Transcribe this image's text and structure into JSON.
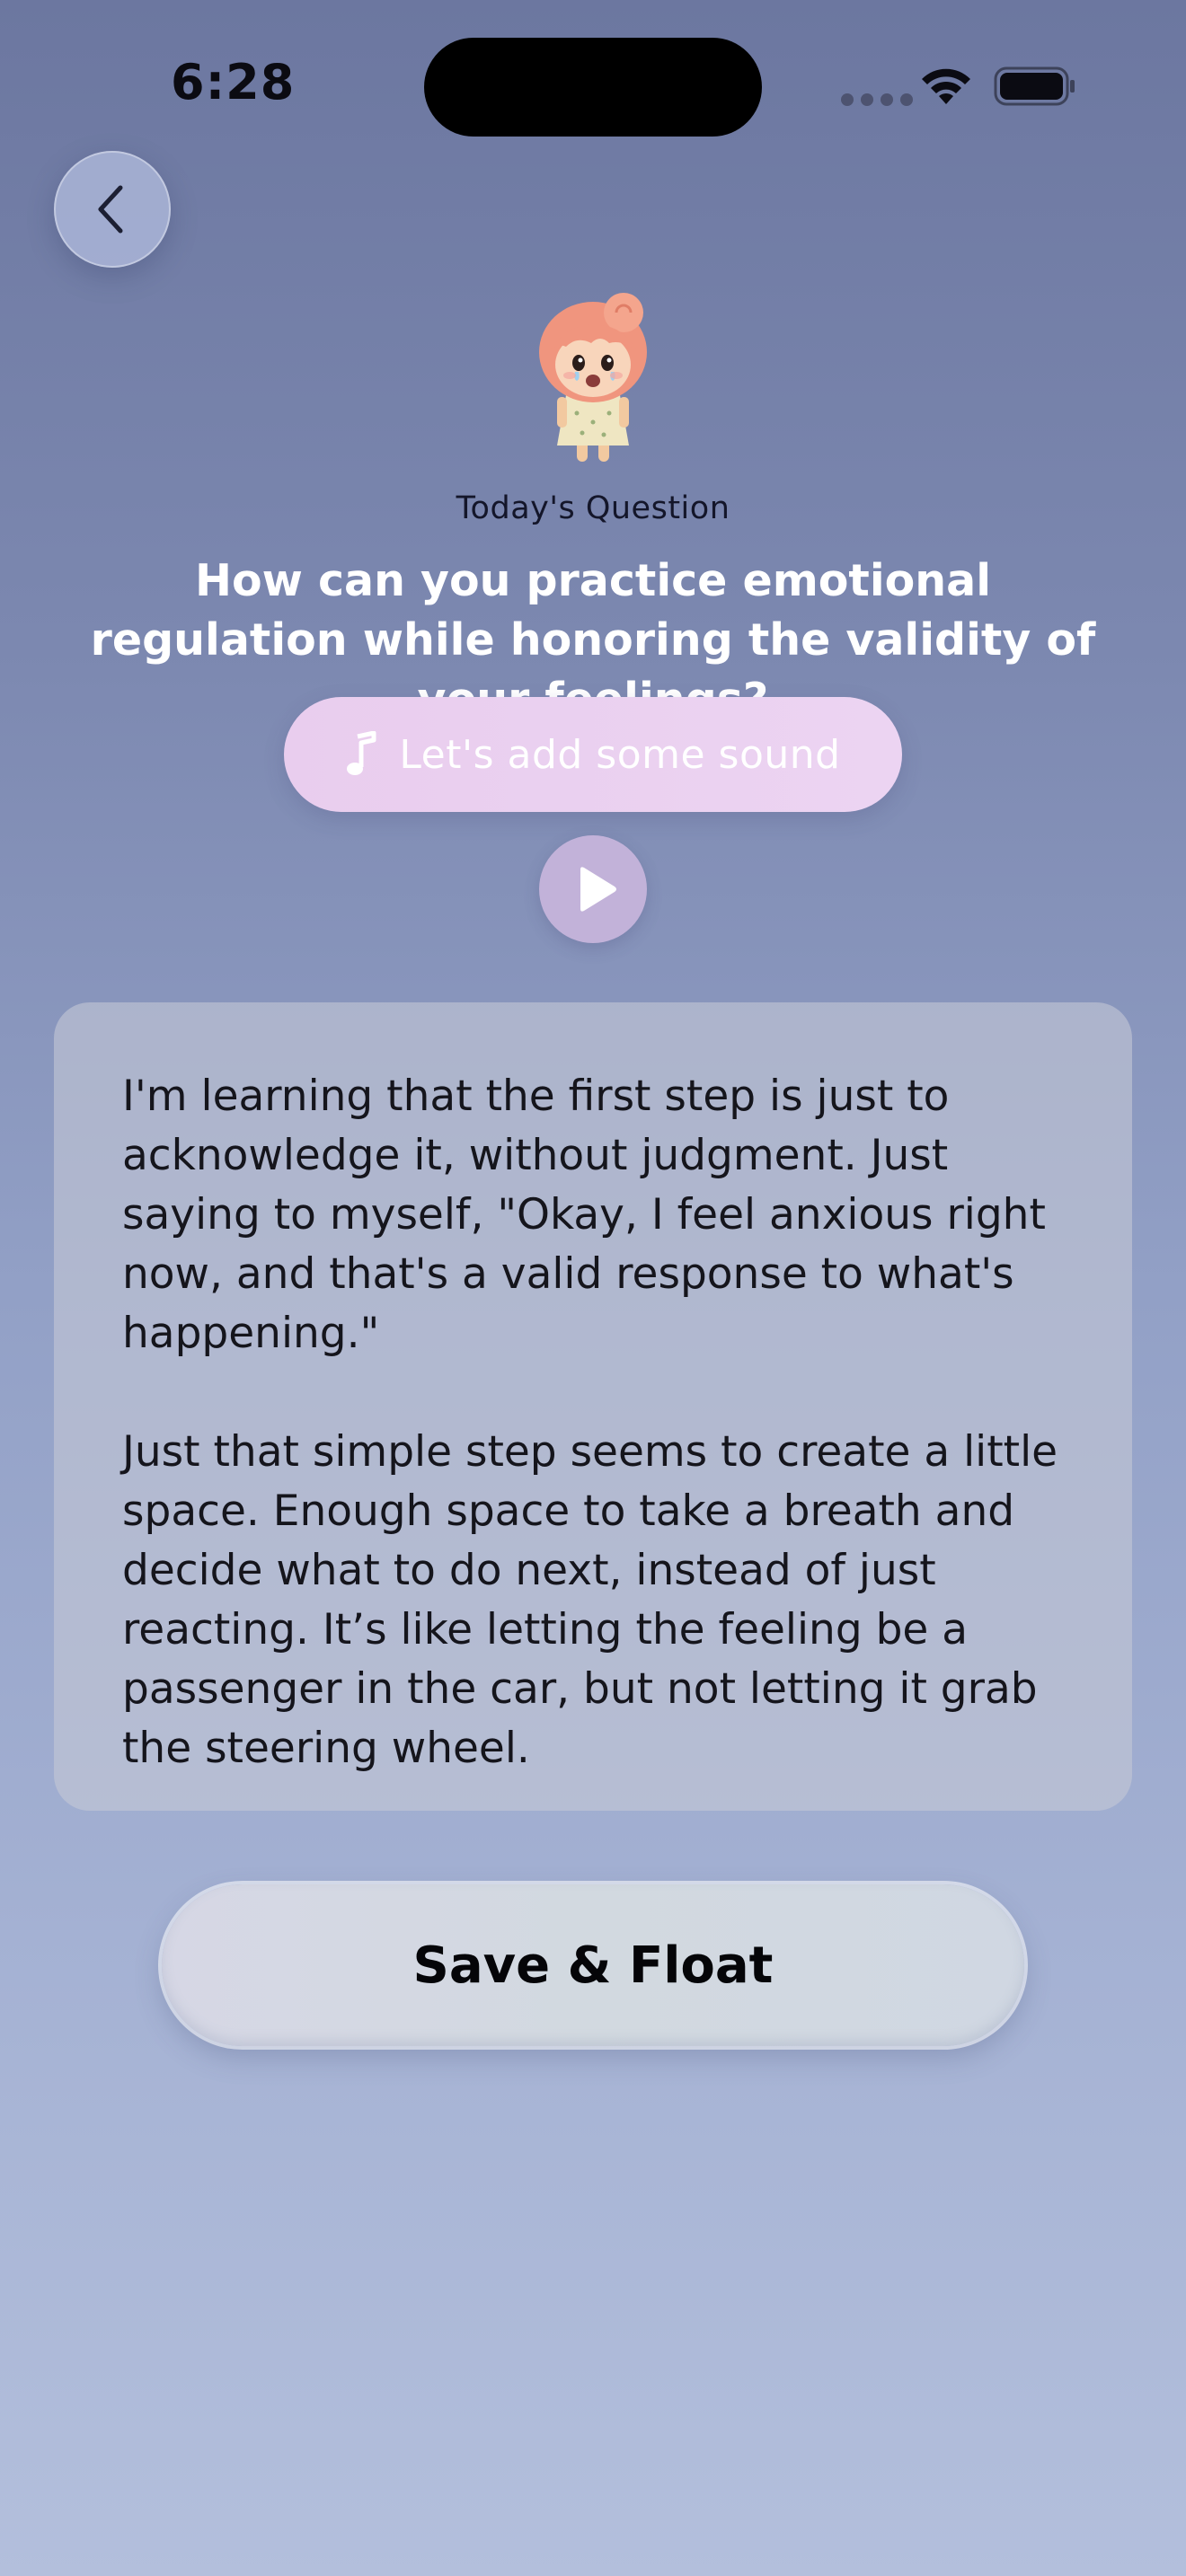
{
  "status_bar": {
    "time": "6:28"
  },
  "header": {
    "back_icon": "chevron-left-icon",
    "avatar": "crying-girl-figurine"
  },
  "question": {
    "label": "Today's Question",
    "text": "How can you practice emotional regulation while honoring the validity of your feelings?"
  },
  "sound": {
    "label": "Let's add some sound",
    "icon": "music-note-icon"
  },
  "play": {
    "icon": "play-icon"
  },
  "journal": {
    "text": "I'm learning that the first step is just to acknowledge it, without judgment. Just saying to myself, \"Okay, I feel anxious right now, and that's a valid response to what's happening.\"\n\nJust that simple step seems to create a little space. Enough space to take a breath and decide what to do next, instead of just reacting. It’s like letting the feeling be a passenger in the car, but not letting it grab the steering wheel."
  },
  "actions": {
    "save_label": "Save & Float"
  },
  "colors": {
    "background_top": "#6c77a0",
    "background_bottom": "#b3bfdc",
    "sound_pill": "#ecd4f2",
    "play_button": "#c2b2d9"
  }
}
